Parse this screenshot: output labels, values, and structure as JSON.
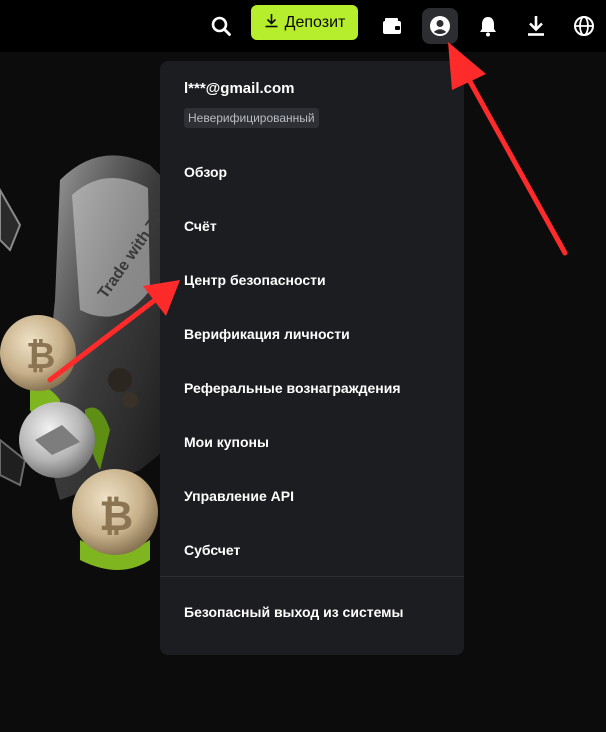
{
  "topbar": {
    "deposit_label": "Депозит",
    "icons": [
      "search-icon",
      "wallet-icon",
      "user-icon",
      "bell-icon",
      "download-icon",
      "globe-icon"
    ]
  },
  "promo": {
    "text": "Trade with Trust"
  },
  "menu": {
    "email": "l***@gmail.com",
    "verification_badge": "Неверифицированный",
    "items": [
      "Обзор",
      "Счёт",
      "Центр безопасности",
      "Верификация личности",
      "Реферальные вознаграждения",
      "Мои купоны",
      "Управление API",
      "Субсчет"
    ],
    "logout": "Безопасный выход из системы"
  },
  "colors": {
    "accent": "#b6ee2e",
    "menu_bg": "#1c1d20",
    "annotation": "#ff2a2a"
  }
}
